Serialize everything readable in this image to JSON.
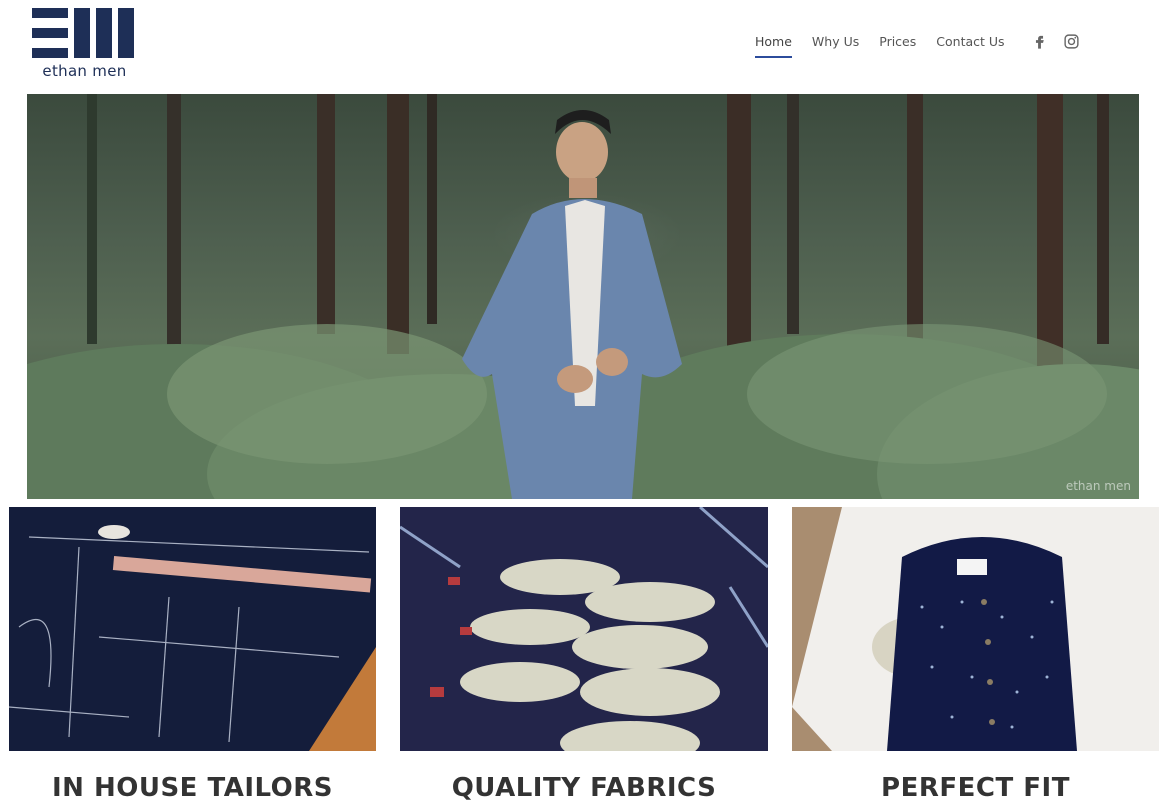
{
  "brand": {
    "name": "ethan men"
  },
  "nav": {
    "items": [
      {
        "label": "Home",
        "active": true
      },
      {
        "label": "Why Us",
        "active": false
      },
      {
        "label": "Prices",
        "active": false
      },
      {
        "label": "Contact Us",
        "active": false
      }
    ]
  },
  "social": {
    "icons": [
      "facebook-icon",
      "instagram-icon"
    ]
  },
  "hero": {
    "watermark": "ethan men"
  },
  "features": [
    {
      "title": "IN HOUSE TAILORS"
    },
    {
      "title": "QUALITY FABRICS"
    },
    {
      "title": "PERFECT FIT"
    }
  ],
  "colors": {
    "brand_navy": "#1e2f57",
    "nav_accent": "#2c4c9c"
  }
}
